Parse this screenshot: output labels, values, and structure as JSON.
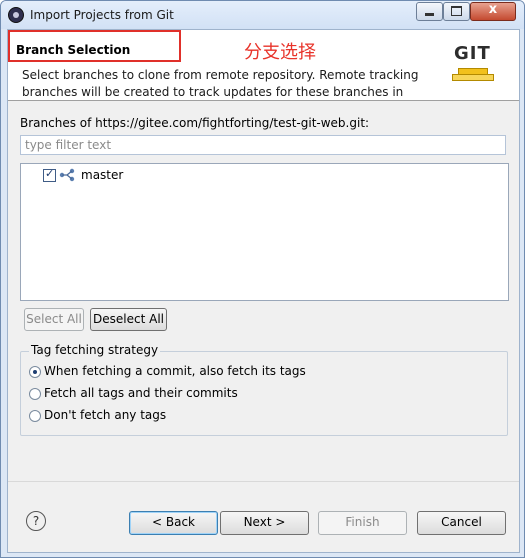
{
  "window": {
    "title": "Import Projects from Git",
    "close_glyph": "x"
  },
  "header": {
    "title": "Branch Selection",
    "annotation": "分支选择",
    "description": "Select branches to clone from remote repository. Remote tracking branches will be created to track updates for these branches in the",
    "logo_text": "GIT"
  },
  "branches": {
    "label": "Branches of https://gitee.com/fightforting/test-git-web.git:",
    "filter_placeholder": "type filter text",
    "items": [
      {
        "name": "master",
        "checked": true,
        "icon": "branch-icon"
      }
    ]
  },
  "selection_buttons": {
    "select_all": "Select All",
    "deselect_all": "Deselect All"
  },
  "tag_strategy": {
    "title": "Tag fetching strategy",
    "options": [
      {
        "label": "When fetching a commit, also fetch its tags",
        "selected": true
      },
      {
        "label": "Fetch all tags and their commits",
        "selected": false
      },
      {
        "label": "Don't fetch any tags",
        "selected": false
      }
    ]
  },
  "footer": {
    "help": "?",
    "back": "< Back",
    "next": "Next >",
    "finish": "Finish",
    "cancel": "Cancel"
  },
  "colors": {
    "annotation_red": "#e0302a",
    "title_bg": "#dce7f5"
  }
}
